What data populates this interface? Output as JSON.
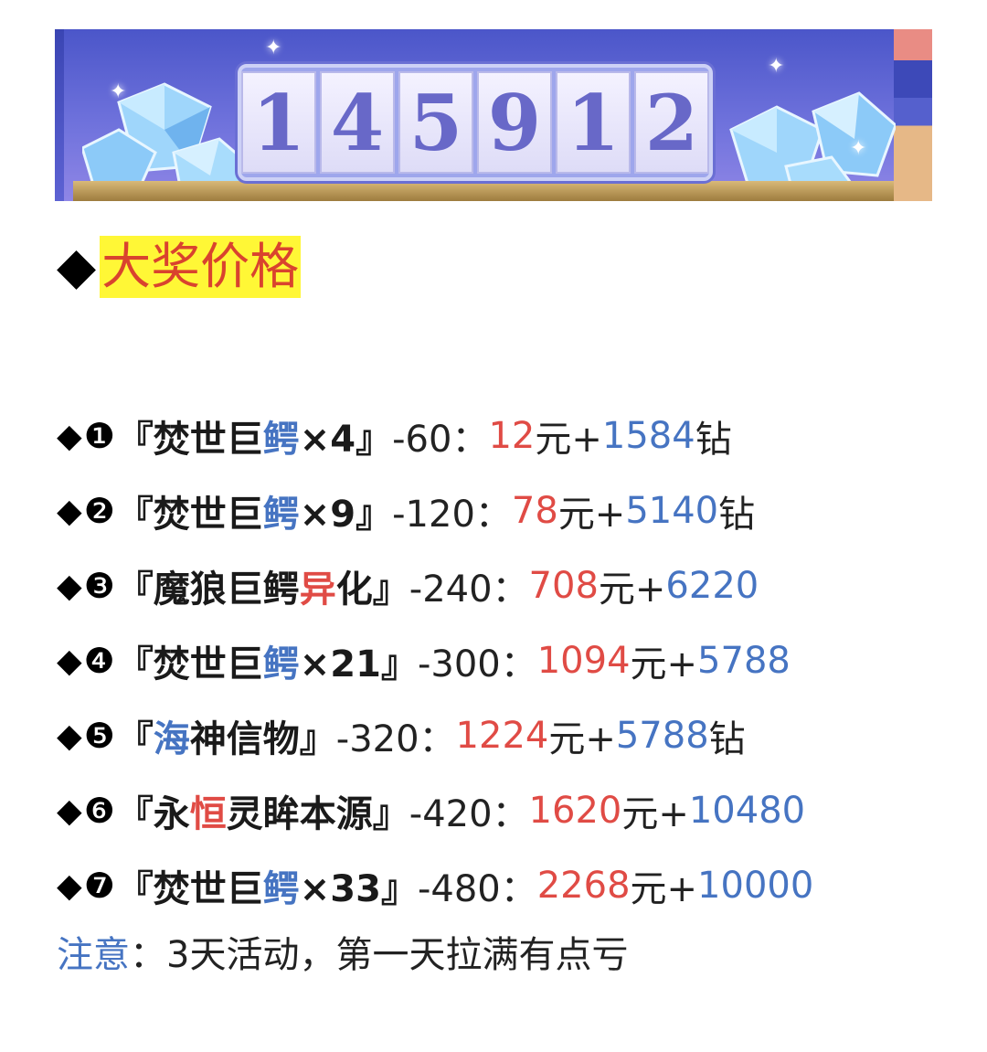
{
  "banner": {
    "counter_digits": [
      "1",
      "4",
      "5",
      "9",
      "1",
      "2"
    ],
    "colors": {
      "bg_top": "#4b56c9",
      "bg_bottom": "#8f86e6",
      "digit": "#6868c8"
    }
  },
  "heading": {
    "bullet": "◆",
    "title": "大奖价格",
    "highlight_color": "#fff736",
    "text_color": "#d9432e"
  },
  "prize_list": [
    {
      "bullet": "◆",
      "number": "❶",
      "open": "『",
      "name_a": "焚世巨",
      "name_b": "鳄",
      "name_c": "×4",
      "name_d": "",
      "close": "』",
      "points": "-60：",
      "yuan": "12",
      "yuan_unit": "元+",
      "diamonds": "1584",
      "diamond_unit": "钻"
    },
    {
      "bullet": "◆",
      "number": "❷",
      "open": "『",
      "name_a": "焚世巨",
      "name_b": "鳄",
      "name_c": "×9",
      "name_d": "",
      "close": "』",
      "points": "-120：",
      "yuan": "78",
      "yuan_unit": "元+",
      "diamonds": "5140",
      "diamond_unit": "钻"
    },
    {
      "bullet": "◆",
      "number": "❸",
      "open": "『",
      "name_a": "魔狼巨鳄",
      "name_b": "异",
      "name_c": "化",
      "name_d": "",
      "close": "』",
      "points": "-240：",
      "yuan": "708",
      "yuan_unit": "元+",
      "diamonds": "6220",
      "diamond_unit": ""
    },
    {
      "bullet": "◆",
      "number": "❹",
      "open": "『",
      "name_a": "焚世巨",
      "name_b": "鳄",
      "name_c": "×21",
      "name_d": "",
      "close": "』",
      "points": "-300：",
      "yuan": "1094",
      "yuan_unit": "元+",
      "diamonds": "5788",
      "diamond_unit": ""
    },
    {
      "bullet": "◆",
      "number": "❺",
      "open": "『",
      "name_a": "",
      "name_b": "海",
      "name_c": "神信物",
      "name_d": "",
      "close": "』",
      "points": "-320：",
      "yuan": "1224",
      "yuan_unit": "元+",
      "diamonds": "5788",
      "diamond_unit": "钻"
    },
    {
      "bullet": "◆",
      "number": "❻",
      "open": "『",
      "name_a": "永",
      "name_b": "恒",
      "name_c": "灵眸本源",
      "name_d": "",
      "close": "』",
      "points": "-420：",
      "yuan": "1620",
      "yuan_unit": "元+",
      "diamonds": "10480",
      "diamond_unit": ""
    },
    {
      "bullet": "◆",
      "number": "❼",
      "open": "『",
      "name_a": "焚世巨",
      "name_b": "鳄",
      "name_c": "×33",
      "name_d": "",
      "close": "』",
      "points": "-480：",
      "yuan": "2268",
      "yuan_unit": "元+",
      "diamonds": "10000",
      "diamond_unit": ""
    }
  ],
  "note": {
    "label": "注意",
    "text": "：3天活动，第一天拉满有点亏"
  },
  "colors": {
    "red": "#e04b45",
    "blue": "#4674c2"
  }
}
